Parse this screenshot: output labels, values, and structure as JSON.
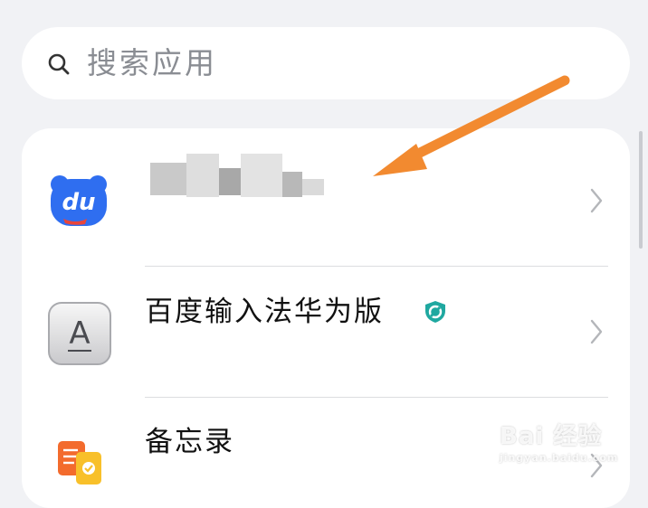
{
  "search": {
    "placeholder": "搜索应用",
    "icon": "search-icon"
  },
  "apps": [
    {
      "name": "",
      "icon": "baidu-du-icon",
      "name_obscured": true
    },
    {
      "name": "百度输入法华为版",
      "icon": "input-method-a-icon",
      "badge_icon": "verified-shield-icon"
    },
    {
      "name": "备忘录",
      "icon": "memo-icon"
    }
  ],
  "annotation": {
    "arrow_color": "#f28a30"
  },
  "watermark": {
    "main": "Bai 经验",
    "sub": "jingyan.baidu.com"
  },
  "colors": {
    "background": "#f1f2f5",
    "card": "#ffffff",
    "du_blue": "#2f6ef0"
  }
}
